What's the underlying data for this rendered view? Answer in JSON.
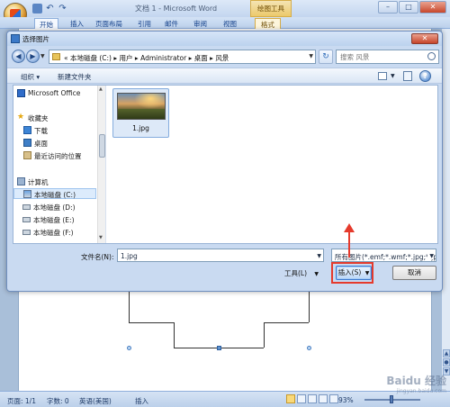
{
  "word": {
    "title": "文档 1 - Microsoft Word",
    "context_tab_group": "绘图工具",
    "tabs": [
      "开始",
      "插入",
      "页面布局",
      "引用",
      "邮件",
      "审阅",
      "视图"
    ],
    "context_tab": "格式",
    "status": {
      "page": "页面: 1/1",
      "words": "字数: 0",
      "language": "英语(美国)",
      "mode": "插入",
      "zoom": "93%"
    }
  },
  "dialog": {
    "title": "选择图片",
    "close_label": "✕",
    "address": {
      "prefix": "«",
      "crumbs": [
        "本地磁盘 (C:)",
        "用户",
        "Administrator",
        "桌面",
        "风景"
      ],
      "separator": "▸"
    },
    "search_placeholder": "搜索 风景",
    "toolbar": {
      "organize": "组织 ▾",
      "new_folder": "新建文件夹"
    },
    "nav": {
      "items": [
        {
          "label": "Microsoft Office"
        },
        {
          "label": "收藏夹"
        },
        {
          "label": "下载"
        },
        {
          "label": "桌面"
        },
        {
          "label": "最近访问的位置"
        },
        {
          "label": "计算机"
        },
        {
          "label": "本地磁盘 (C:)"
        },
        {
          "label": "本地磁盘 (D:)"
        },
        {
          "label": "本地磁盘 (E:)"
        },
        {
          "label": "本地磁盘 (F:)"
        }
      ]
    },
    "files": [
      {
        "name": "1.jpg"
      }
    ],
    "filename_label": "文件名(N):",
    "filename_value": "1.jpg",
    "filter_value": "所有图片(*.emf;*.wmf;*.jpg;*.jp",
    "tools_label": "工具(L)",
    "insert_label": "插入(S)",
    "cancel_label": "取消"
  },
  "watermark": {
    "brand": "Baidu 经验",
    "sub": "jingyan.baidu.com"
  }
}
